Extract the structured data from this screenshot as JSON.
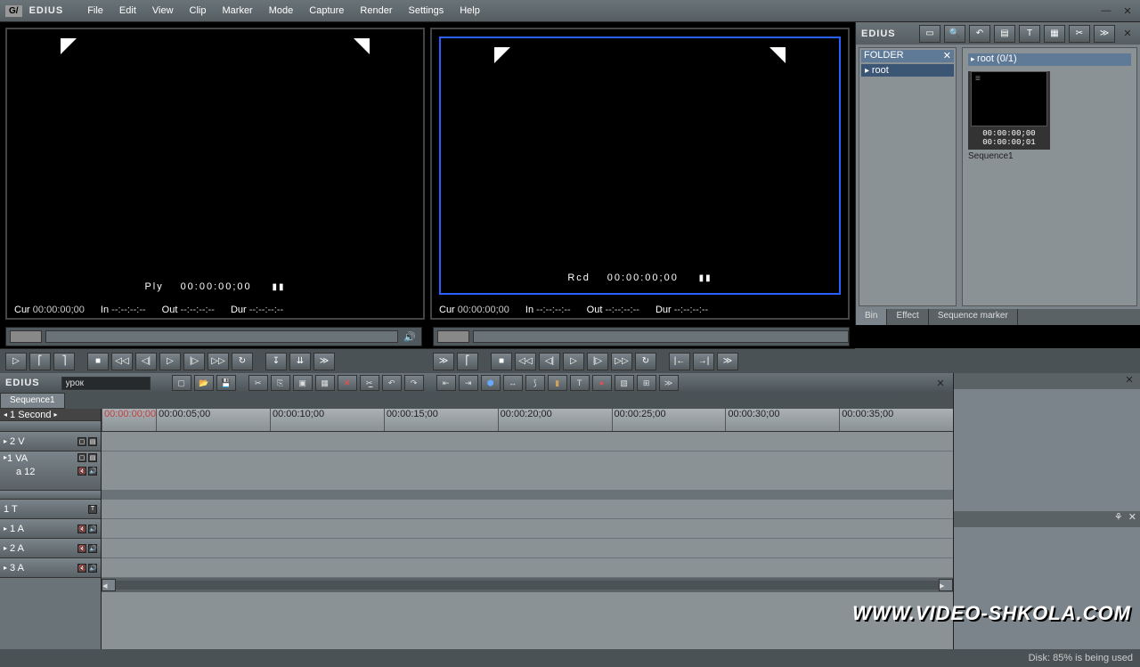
{
  "app": {
    "title": "EDIUS",
    "logo": "G/"
  },
  "menu": [
    "File",
    "Edit",
    "View",
    "Clip",
    "Marker",
    "Mode",
    "Capture",
    "Render",
    "Settings",
    "Help"
  ],
  "player": {
    "label": "Ply",
    "timecode": "00:00:00;00",
    "cur_label": "Cur",
    "cur": "00:00:00;00",
    "in_label": "In",
    "in": "--:--:--:--",
    "out_label": "Out",
    "out": "--:--:--:--",
    "dur_label": "Dur",
    "dur": "--:--:--:--"
  },
  "recorder": {
    "label": "Rcd",
    "timecode": "00:00:00;00",
    "cur_label": "Cur",
    "cur": "00:00:00;00",
    "in_label": "In",
    "in": "--:--:--:--",
    "out_label": "Out",
    "out": "--:--:--:--",
    "dur_label": "Dur",
    "dur": "--:--:--:--"
  },
  "bin": {
    "title": "EDIUS",
    "folder_header": "FOLDER",
    "root_hdr": "root (0/1)",
    "root_label": "root",
    "clip": {
      "tc1": "00:00:00;00",
      "tc2": "00:00:00;01",
      "name": "Sequence1"
    },
    "tabs": [
      "Bin",
      "Effect",
      "Sequence marker"
    ]
  },
  "timeline": {
    "title": "EDIUS",
    "project_name": "урок",
    "seq_tab": "Sequence1",
    "zoom": "1 Second",
    "playhead_tc": "00:00:00;00",
    "ticks": [
      "00:00:05;00",
      "00:00:10;00",
      "00:00:15;00",
      "00:00:20;00",
      "00:00:25;00",
      "00:00:30;00",
      "00:00:35;00"
    ],
    "tracks": {
      "v2": "2 V",
      "va1": "1 VA",
      "va1_sub": "a 12",
      "t1": "1 T",
      "a1": "1 A",
      "a2": "2 A",
      "a3": "3 A"
    }
  },
  "status": {
    "disk": "Disk: 85% is being used"
  },
  "watermark": "WWW.VIDEO-SHKOLA.COM"
}
